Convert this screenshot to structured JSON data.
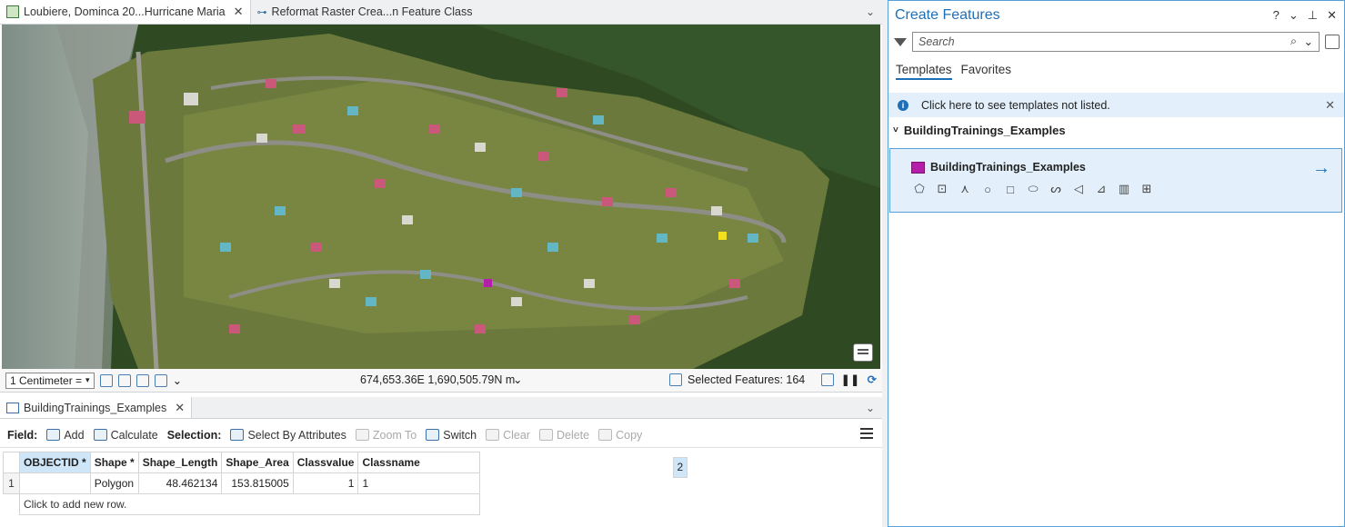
{
  "tabs": [
    {
      "label": "Loubiere, Dominca 20...Hurricane Maria",
      "active": true
    },
    {
      "label": "Reformat Raster Crea...n Feature Class",
      "active": false
    }
  ],
  "status": {
    "scale": "1 Centimeter =",
    "coordinates": "674,653.36E 1,690,505.79N m",
    "selected_features": "Selected Features: 164"
  },
  "table_pane": {
    "tab_label": "BuildingTrainings_Examples",
    "toolbar": {
      "field_label": "Field:",
      "add": "Add",
      "calculate": "Calculate",
      "selection_label": "Selection:",
      "select_by_attributes": "Select By Attributes",
      "zoom_to": "Zoom To",
      "switch": "Switch",
      "clear": "Clear",
      "delete": "Delete",
      "copy": "Copy"
    },
    "columns": [
      "OBJECTID *",
      "Shape *",
      "Shape_Length",
      "Shape_Area",
      "Classvalue",
      "Classname"
    ],
    "rows": [
      {
        "row_num": "1",
        "cells": [
          "2",
          "Polygon",
          "48.462134",
          "153.815005",
          "1",
          "1"
        ]
      }
    ],
    "add_row_text": "Click to add new row."
  },
  "create_features": {
    "title": "Create Features",
    "controls": [
      "?",
      "⌄",
      "⊥",
      "✕"
    ],
    "search_placeholder": "Search",
    "tabs": [
      "Templates",
      "Favorites"
    ],
    "info": "Click here to see templates not listed.",
    "group_name": "BuildingTrainings_Examples",
    "template_name": "BuildingTrainings_Examples",
    "template_color": "#b41ea8"
  },
  "colors": {
    "accent": "#1e6fb8",
    "selected_cell": "#cfe6f8",
    "info_bg": "#e3f0fb"
  }
}
